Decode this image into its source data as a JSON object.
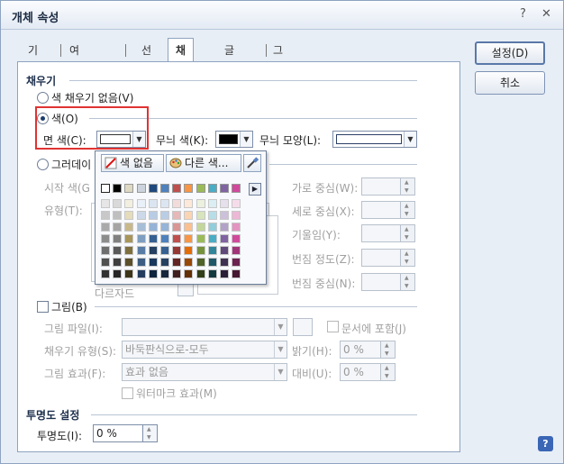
{
  "window": {
    "title": "개체 속성",
    "help_glyph": "?",
    "close_glyph": "✕"
  },
  "tabs": [
    {
      "label": "기본"
    },
    {
      "label": "여백/캡션"
    },
    {
      "label": "선"
    },
    {
      "label": "채우기",
      "active": true
    },
    {
      "label": "글상자"
    },
    {
      "label": "그림자"
    }
  ],
  "buttons": {
    "ok": "설정(D)",
    "cancel": "취소"
  },
  "fill": {
    "group_title": "채우기",
    "no_fill": "색 채우기 없음(V)",
    "color_option": "색(O)",
    "face_color_label": "면 색(C):",
    "pattern_color_label": "무늬 색(K):",
    "pattern_shape_label": "무늬 모양(L):",
    "gradient_option": "그러데이",
    "start_color_label": "시작 색(G",
    "type_label": "유형(T):",
    "type_value": "다르자드",
    "h_center_label": "가로 중심(W):",
    "v_center_label": "세로 중심(X):",
    "slope_label": "기울임(Y):",
    "blur_label": "번짐 정도(Z):",
    "blur_center_label": "번짐 중심(N):"
  },
  "picture": {
    "title": "그림(B)",
    "file_label": "그림 파일(I):",
    "embed_label": "문서에 포함(J)",
    "fill_type_label": "채우기 유형(S):",
    "fill_type_value": "바둑판식으로-모두",
    "brightness_label": "밝기(H):",
    "brightness_value": "0 %",
    "effect_label": "그림 효과(F):",
    "effect_value": "효과 없음",
    "contrast_label": "대비(U):",
    "contrast_value": "0 %",
    "watermark_label": "워터마크 효과(M)"
  },
  "transparency": {
    "group_title": "투명도 설정",
    "label": "투명도(I):",
    "value": "0 %"
  },
  "color_popup": {
    "no_color": "색 없음",
    "other_color": "다른 색...",
    "theme_row": [
      "#ffffff",
      "#000000",
      "#ddd9c3",
      "#ccd3dc",
      "#1f497d",
      "#4f81bd",
      "#c0504d",
      "#f79646",
      "#9bbb59",
      "#4bacc6",
      "#8064a2",
      "#d04a9c"
    ],
    "columns": [
      [
        "#e6e6e6",
        "#c8c8c8",
        "#aaaaaa",
        "#8c8c8c",
        "#6e6e6e",
        "#505050",
        "#323232"
      ],
      [
        "#d9d9d9",
        "#bfbfbf",
        "#a5a5a5",
        "#808080",
        "#595959",
        "#3f3f3f",
        "#262626"
      ],
      [
        "#f2efe0",
        "#e4dcba",
        "#c9b98a",
        "#a8955a",
        "#7f6f3e",
        "#5c502b",
        "#3d3519"
      ],
      [
        "#eaf0f7",
        "#cdd9e8",
        "#a8bdd6",
        "#7f9ec0",
        "#587ca5",
        "#3d5c82",
        "#243c5e"
      ],
      [
        "#dbe5f1",
        "#b8cce4",
        "#95b3d7",
        "#366092",
        "#244062",
        "#17375d",
        "#0f243e"
      ],
      [
        "#dce6f2",
        "#b9cde5",
        "#95b4d8",
        "#4f81bd",
        "#376092",
        "#254061",
        "#17263d"
      ],
      [
        "#f2dcdb",
        "#e6b8b7",
        "#d99694",
        "#c0504d",
        "#953735",
        "#632523",
        "#40201f"
      ],
      [
        "#fde9d9",
        "#fbd4b4",
        "#fac08f",
        "#f79646",
        "#e36c09",
        "#984806",
        "#632f04"
      ],
      [
        "#ebf1de",
        "#d7e4bc",
        "#c3d69b",
        "#9bbb59",
        "#76923c",
        "#4f6228",
        "#323f19"
      ],
      [
        "#daeef3",
        "#b7dee8",
        "#92cddc",
        "#4bacc6",
        "#31859b",
        "#205867",
        "#133940"
      ],
      [
        "#e5e0ec",
        "#ccc0da",
        "#b2a2c7",
        "#8064a2",
        "#5f497a",
        "#3f3151",
        "#2a2036"
      ],
      [
        "#f6dcea",
        "#edb8d5",
        "#e394c0",
        "#d04a9c",
        "#a13478",
        "#6c2350",
        "#451732"
      ]
    ]
  },
  "colors": {
    "face_color": "#ffffff",
    "pattern_color": "#000000",
    "highlight": "#e03333"
  }
}
